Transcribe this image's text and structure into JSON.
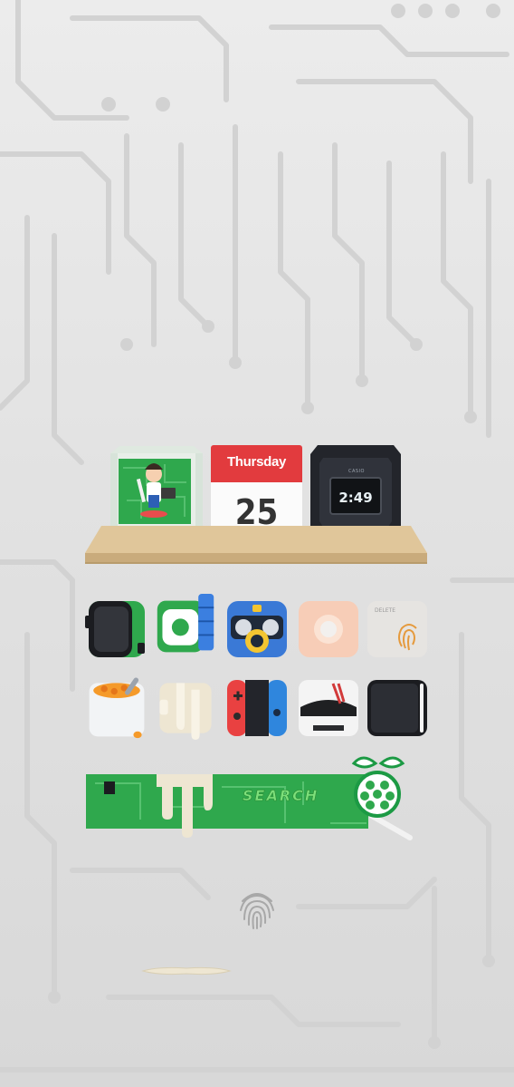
{
  "wallpaper": {
    "theme": "circuit-board",
    "colors": {
      "base": "#e4e4e4",
      "trace": "#cfcfcf"
    }
  },
  "widgets": {
    "calendar": {
      "day": "Thursday",
      "date": "25",
      "header_color": "#e23b3e"
    },
    "watch": {
      "brand": "CASIO",
      "time": "2:49"
    }
  },
  "apps_row1": [
    {
      "icon": "phone-case-icon"
    },
    {
      "icon": "rubiks-cube-icon"
    },
    {
      "icon": "camera-robot-icon"
    },
    {
      "icon": "push-button-icon"
    },
    {
      "icon": "fingerprint-scanner-icon",
      "label": "DELETE"
    }
  ],
  "apps_row2": [
    {
      "icon": "soup-bowl-icon"
    },
    {
      "icon": "paint-drip-icon"
    },
    {
      "icon": "game-controller-icon"
    },
    {
      "icon": "stormtrooper-icon"
    },
    {
      "icon": "black-phone-icon"
    }
  ],
  "search": {
    "label": "SEARCH",
    "icon": "raspberry-pi-search-icon"
  },
  "bottom": {
    "fingerprint_icon": "fingerprint-icon",
    "handle": "dock-handle"
  }
}
